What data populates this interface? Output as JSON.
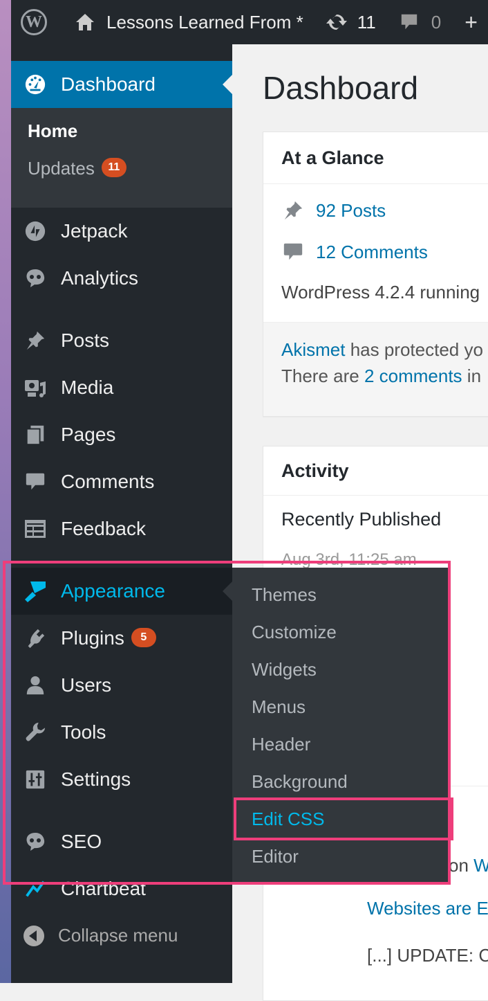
{
  "adminbar": {
    "site_name": "Lessons Learned From *",
    "updates_count": "11",
    "comments_count": "0",
    "new_label": "+"
  },
  "sidebar": {
    "dashboard": "Dashboard",
    "dashboard_sub": {
      "home": "Home",
      "updates": "Updates",
      "updates_badge": "11"
    },
    "items": [
      {
        "id": "jetpack",
        "label": "Jetpack",
        "icon": "jetpack-icon"
      },
      {
        "id": "analytics",
        "label": "Analytics",
        "icon": "analytics-icon"
      },
      {
        "id": "posts",
        "label": "Posts",
        "icon": "pin-icon"
      },
      {
        "id": "media",
        "label": "Media",
        "icon": "media-icon"
      },
      {
        "id": "pages",
        "label": "Pages",
        "icon": "pages-icon"
      },
      {
        "id": "comments",
        "label": "Comments",
        "icon": "comment-icon"
      },
      {
        "id": "feedback",
        "label": "Feedback",
        "icon": "feedback-icon"
      },
      {
        "id": "appearance",
        "label": "Appearance",
        "icon": "brush-icon"
      },
      {
        "id": "plugins",
        "label": "Plugins",
        "icon": "plugin-icon",
        "badge": "5"
      },
      {
        "id": "users",
        "label": "Users",
        "icon": "user-icon"
      },
      {
        "id": "tools",
        "label": "Tools",
        "icon": "wrench-icon"
      },
      {
        "id": "settings",
        "label": "Settings",
        "icon": "settings-icon"
      },
      {
        "id": "seo",
        "label": "SEO",
        "icon": "seo-icon"
      },
      {
        "id": "chartbeat",
        "label": "Chartbeat",
        "icon": "chartbeat-icon"
      }
    ],
    "collapse": "Collapse menu"
  },
  "appearance_submenu": [
    "Themes",
    "Customize",
    "Widgets",
    "Menus",
    "Header",
    "Background",
    "Edit CSS",
    "Editor"
  ],
  "main": {
    "title": "Dashboard",
    "at_a_glance": {
      "title": "At a Glance",
      "posts": "92 Posts",
      "comments": "12 Comments",
      "version": "WordPress 4.2.4 running",
      "akismet_link": "Akismet",
      "akismet_text": " has protected yo",
      "there_are": "There are ",
      "pending_link": "2 comments",
      "pending_tail": " in"
    },
    "activity": {
      "title": "Activity",
      "recently_published": "Recently Published",
      "date_partial": "Aug 3rd, 11:25 am"
    },
    "lower": {
      "on_text": "on ",
      "on_link": "W",
      "link_title": "Websites are E",
      "excerpt": "[...] UPDATE: C"
    }
  },
  "colors": {
    "accent": "#0073aa",
    "highlight_frame": "#ee3e7b",
    "sidebar": "#23282d",
    "badge": "#d54e21"
  }
}
